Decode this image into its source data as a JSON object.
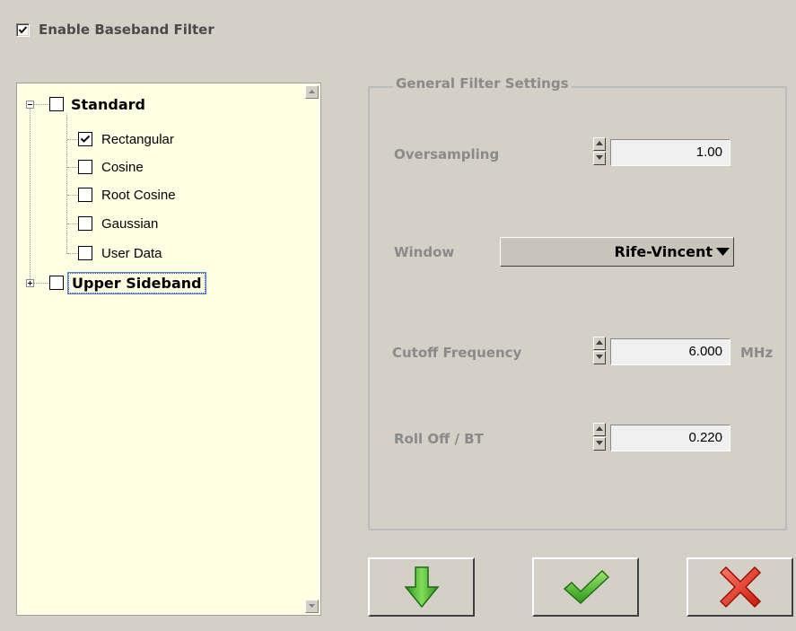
{
  "enable": {
    "label": "Enable Baseband Filter",
    "checked": true
  },
  "tree": {
    "groups": [
      {
        "label": "Standard",
        "expanded": true,
        "checked": false,
        "children": [
          {
            "label": "Rectangular",
            "checked": true
          },
          {
            "label": "Cosine",
            "checked": false
          },
          {
            "label": "Root Cosine",
            "checked": false
          },
          {
            "label": "Gaussian",
            "checked": false
          },
          {
            "label": "User Data",
            "checked": false
          }
        ]
      },
      {
        "label": "Upper Sideband",
        "expanded": false,
        "checked": false,
        "selected": true
      }
    ]
  },
  "settings": {
    "title": "General Filter Settings",
    "oversampling": {
      "label": "Oversampling",
      "value": "1.00"
    },
    "window": {
      "label": "Window",
      "value": "Rife-Vincent"
    },
    "cutoff": {
      "label": "Cutoff Frequency",
      "value": "6.000",
      "unit": "MHz"
    },
    "rolloff": {
      "label": "Roll Off / BT",
      "value": "0.220"
    }
  },
  "buttons": {
    "apply_icon": "green-down-arrow-icon",
    "ok_icon": "green-check-icon",
    "cancel_icon": "red-x-icon"
  },
  "colors": {
    "tree_bg": "#ffffe4",
    "dialog_bg": "#d4d0c8",
    "disabled_text": "#8a8a8a"
  }
}
